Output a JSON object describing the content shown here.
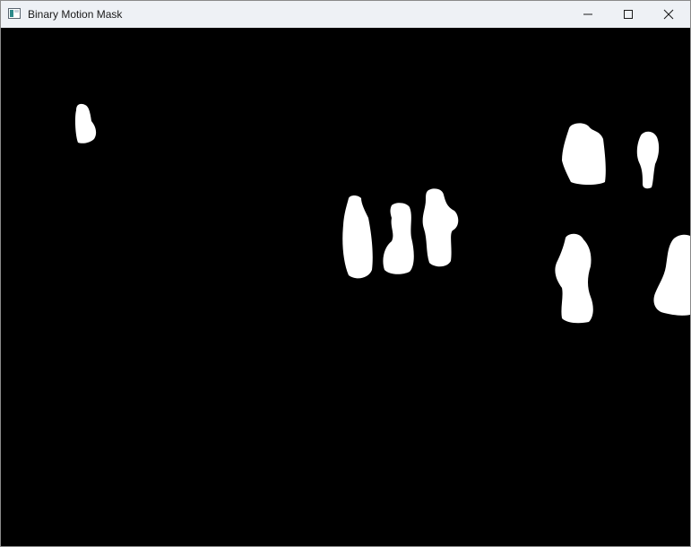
{
  "window": {
    "title": "Binary Motion Mask",
    "controls": {
      "minimize": "minimize-icon",
      "maximize": "maximize-icon",
      "close": "close-icon"
    }
  },
  "colors": {
    "titlebar": "#eef1f5",
    "mask_background": "#000000",
    "mask_foreground": "#ffffff"
  }
}
